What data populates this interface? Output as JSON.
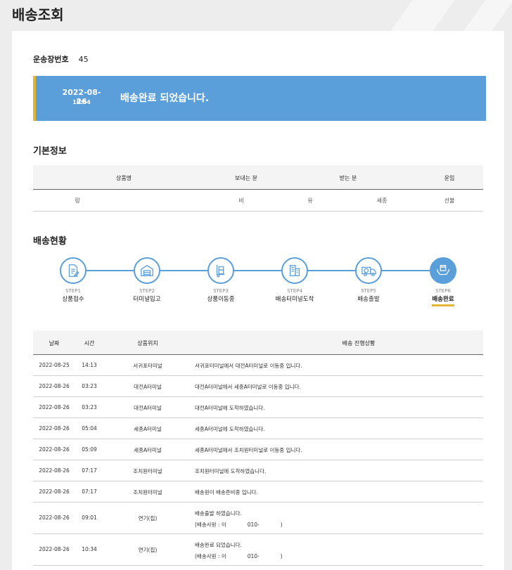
{
  "page": {
    "title": "배송조회"
  },
  "waybill": {
    "label": "운송장번호",
    "value": "45"
  },
  "status": {
    "date": "2022-08-26",
    "time": "10:34",
    "message": "배송완료 되었습니다."
  },
  "basic_info": {
    "title": "기본정보",
    "headers": [
      "상품명",
      "보내는 분",
      "받는 분",
      "운임"
    ],
    "row": [
      "링",
      "비",
      "유",
      "세종",
      "선불"
    ]
  },
  "delivery": {
    "title": "배송현황",
    "steps": [
      {
        "num": "STEP1",
        "name": "상품접수",
        "icon": "document-pen-icon"
      },
      {
        "num": "STEP2",
        "name": "터미널입고",
        "icon": "warehouse-icon"
      },
      {
        "num": "STEP3",
        "name": "상품이동중",
        "icon": "hand-truck-icon"
      },
      {
        "num": "STEP4",
        "name": "배송터미널도착",
        "icon": "buildings-icon"
      },
      {
        "num": "STEP5",
        "name": "배송출발",
        "icon": "delivery-truck-icon"
      },
      {
        "num": "STEP6",
        "name": "배송완료",
        "icon": "hands-package-icon",
        "active": true
      }
    ]
  },
  "tracking": {
    "headers": [
      "날짜",
      "시간",
      "상품위치",
      "배송 진행상황"
    ],
    "rows": [
      {
        "date": "2022-08-25",
        "time": "14:13",
        "location": "서귀포터미널",
        "status": "서귀포터미널에서 대전A터미널로 이동중 입니다."
      },
      {
        "date": "2022-08-26",
        "time": "03:23",
        "location": "대전A터미널",
        "status": "대전A터미널에서 세종A터미널로 이동중 입니다."
      },
      {
        "date": "2022-08-26",
        "time": "03:23",
        "location": "대전A터미널",
        "status": "대전A터미널에 도착하였습니다."
      },
      {
        "date": "2022-08-26",
        "time": "05:04",
        "location": "세종A터미널",
        "status": "세종A터미널에 도착하였습니다."
      },
      {
        "date": "2022-08-26",
        "time": "05:09",
        "location": "세종A터미널",
        "status": "세종A터미널에서 조치원터미널로 이동중 입니다."
      },
      {
        "date": "2022-08-26",
        "time": "07:17",
        "location": "조치원터미널",
        "status": "조치원터미널에 도착하였습니다."
      },
      {
        "date": "2022-08-26",
        "time": "07:17",
        "location": "조치원터미널",
        "status": "배송원이 배송준비중 입니다."
      },
      {
        "date": "2022-08-26",
        "time": "09:01",
        "location": "연기(집)",
        "status": "배송출발 하였습니다.",
        "sub_a": "(배송사원 : 이",
        "sub_b": "010-",
        "sub_c": ")"
      },
      {
        "date": "2022-08-26",
        "time": "10:34",
        "location": "연기(집)",
        "status": "배송완료 되었습니다.",
        "sub_a": "(배송사원 : 이",
        "sub_b": "010-",
        "sub_c": ")"
      }
    ]
  },
  "colors": {
    "accent": "#5a9fda",
    "highlight": "#e2b634"
  }
}
